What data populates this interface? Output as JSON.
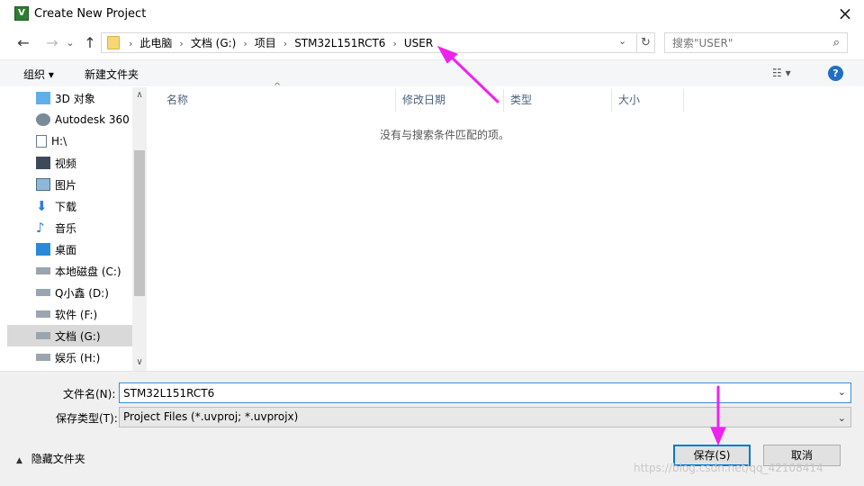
{
  "window": {
    "title": "Create New Project",
    "app_icon_text": "V"
  },
  "address": {
    "breadcrumbs": [
      "此电脑",
      "文档 (G:)",
      "项目",
      "STM32L151RCT6",
      "USER"
    ]
  },
  "search": {
    "placeholder": "搜索\"USER\""
  },
  "toolbar": {
    "organize": "组织 ▾",
    "new_folder": "新建文件夹"
  },
  "sidebar": {
    "items": [
      {
        "label": "3D 对象",
        "icon": "cube-icon"
      },
      {
        "label": "Autodesk 360",
        "icon": "cloud-icon"
      },
      {
        "label": "H:\\",
        "icon": "document-icon"
      },
      {
        "label": "视频",
        "icon": "film-icon"
      },
      {
        "label": "图片",
        "icon": "picture-icon"
      },
      {
        "label": "下载",
        "icon": "download-icon"
      },
      {
        "label": "音乐",
        "icon": "music-icon"
      },
      {
        "label": "桌面",
        "icon": "desktop-icon"
      },
      {
        "label": "本地磁盘 (C:)",
        "icon": "drive-icon"
      },
      {
        "label": "Q小鑫 (D:)",
        "icon": "drive-icon"
      },
      {
        "label": "软件 (F:)",
        "icon": "drive-icon"
      },
      {
        "label": "文档 (G:)",
        "icon": "drive-icon",
        "selected": true
      },
      {
        "label": "娱乐 (H:)",
        "icon": "drive-icon"
      }
    ]
  },
  "columns": [
    "名称",
    "修改日期",
    "类型",
    "大小"
  ],
  "empty_message": "没有与搜索条件匹配的项。",
  "file_name": {
    "label": "文件名(N):",
    "value": "STM32L151RCT6"
  },
  "file_type": {
    "label": "保存类型(T):",
    "value": "Project Files (*.uvproj; *.uvprojx)"
  },
  "hide_folders": "隐藏文件夹",
  "buttons": {
    "save": "保存(S)",
    "cancel": "取消"
  },
  "watermark": "https://blog.csdn.net/qq_42108414",
  "annotation_color": "#ee22ee"
}
